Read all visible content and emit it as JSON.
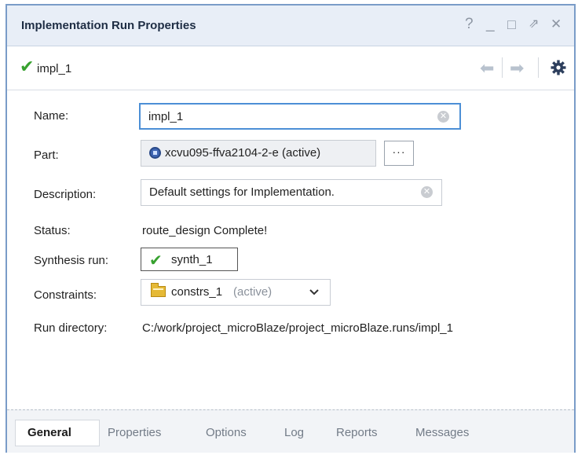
{
  "window": {
    "title": "Implementation Run Properties",
    "controls": {
      "help": "?",
      "minimize": "_",
      "maximize": "□",
      "float": "⇗",
      "close": "✕"
    }
  },
  "toolbar": {
    "run_name": "impl_1",
    "status_icon": "check-icon",
    "back_icon": "arrow-left-icon",
    "forward_icon": "arrow-right-icon",
    "settings_icon": "gear-icon"
  },
  "form": {
    "name": {
      "label": "Name:",
      "value": "impl_1"
    },
    "part": {
      "label": "Part:",
      "value": "xcvu095-ffva2104-2-e (active)",
      "browse_label": "···"
    },
    "description": {
      "label": "Description:",
      "value": "Default settings for Implementation."
    },
    "status": {
      "label": "Status:",
      "value": "route_design Complete!"
    },
    "synthesis_run": {
      "label": "Synthesis run:",
      "value": "synth_1"
    },
    "constraints": {
      "label": "Constraints:",
      "value": "constrs_1",
      "suffix": "(active)"
    },
    "run_directory": {
      "label": "Run directory:",
      "value": "C:/work/project_microBlaze/project_microBlaze.runs/impl_1"
    }
  },
  "tabs": [
    {
      "label": "General",
      "active": true
    },
    {
      "label": "Properties",
      "active": false
    },
    {
      "label": "Options",
      "active": false
    },
    {
      "label": "Log",
      "active": false
    },
    {
      "label": "Reports",
      "active": false
    },
    {
      "label": "Messages",
      "active": false
    }
  ],
  "colors": {
    "title_bar": "#e8eef7",
    "frame_border": "#7a9cc8",
    "focus_border": "#4c8fd6",
    "success_green": "#37a12f",
    "chip_blue": "#3f66b3"
  }
}
